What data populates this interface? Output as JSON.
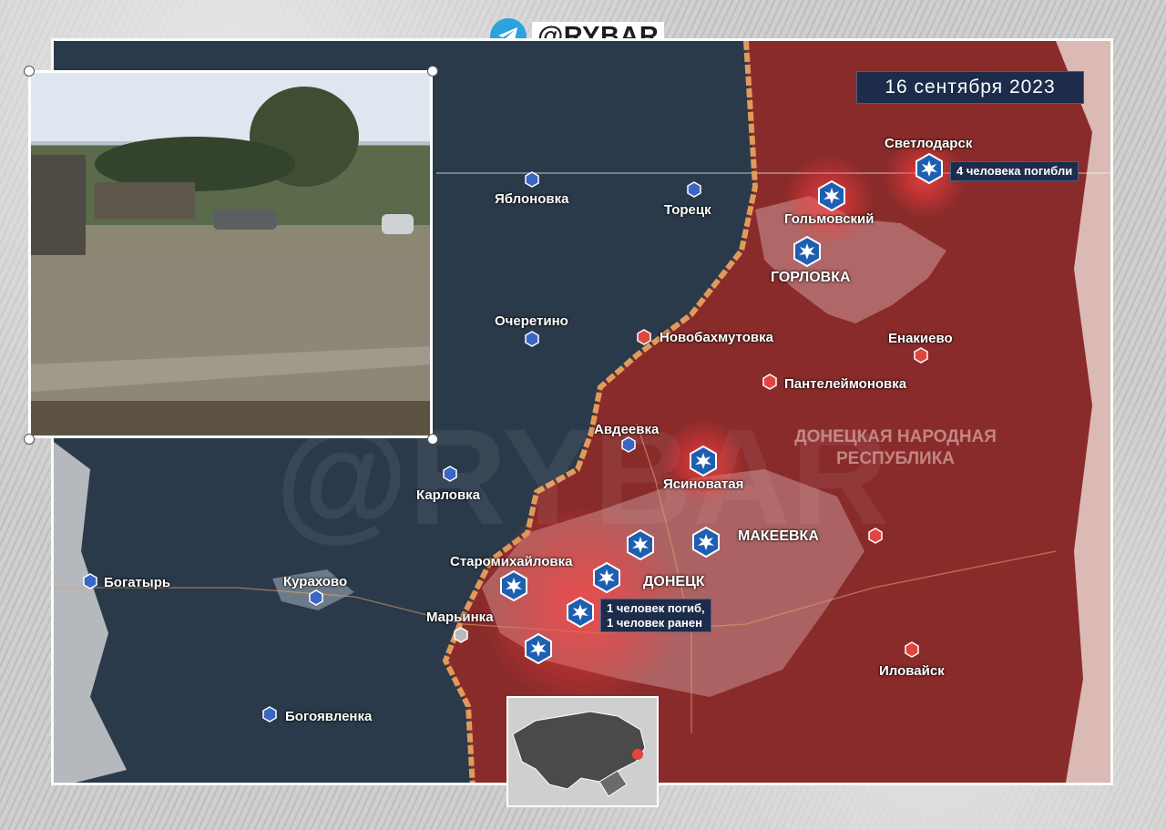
{
  "header": {
    "brand": "@RYBAR"
  },
  "date": "16 сентября 2023",
  "region_label": "ДОНЕЦКАЯ НАРОДНАЯ РЕСПУБЛИКА",
  "notes": {
    "svetlodarsk": "4 человека погибли",
    "donetsk_line1": "1 человек погиб,",
    "donetsk_line2": "1 человек ранен"
  },
  "cities": {
    "svetlodarsk": "Светлодарск",
    "golmovsky": "Гольмовский",
    "gorlovka": "ГОРЛОВКА",
    "yablonovka": "Яблоновка",
    "toretsk": "Торецк",
    "ocheretino": "Очеретино",
    "novobakhmutovka": "Новобахмутовка",
    "enakievo": "Енакиево",
    "panteleimonovka": "Пантелеймоновка",
    "avdeevka": "Авдеевка",
    "yasinovataya": "Ясиноватая",
    "karlovka": "Карловка",
    "makeevka": "МАКЕЕВКА",
    "staromikhaylovka": "Старомихайловка",
    "donetsk": "ДОНЕЦК",
    "bogatyr": "Богатырь",
    "kurakhovo": "Курахово",
    "marinka": "Марьинка",
    "ilovaysk": "Иловайск",
    "bogoyavlenka": "Богоявленка"
  },
  "colors": {
    "ukraine_side": "#2b3a4b",
    "russia_side": "#8a2b2b",
    "frontline": "#e29a5a",
    "strike_icon": "#1f5fb0",
    "note_bg": "#1c2c4a"
  },
  "icons": [
    "telegram-icon",
    "explosion-icon",
    "pin-icon"
  ]
}
